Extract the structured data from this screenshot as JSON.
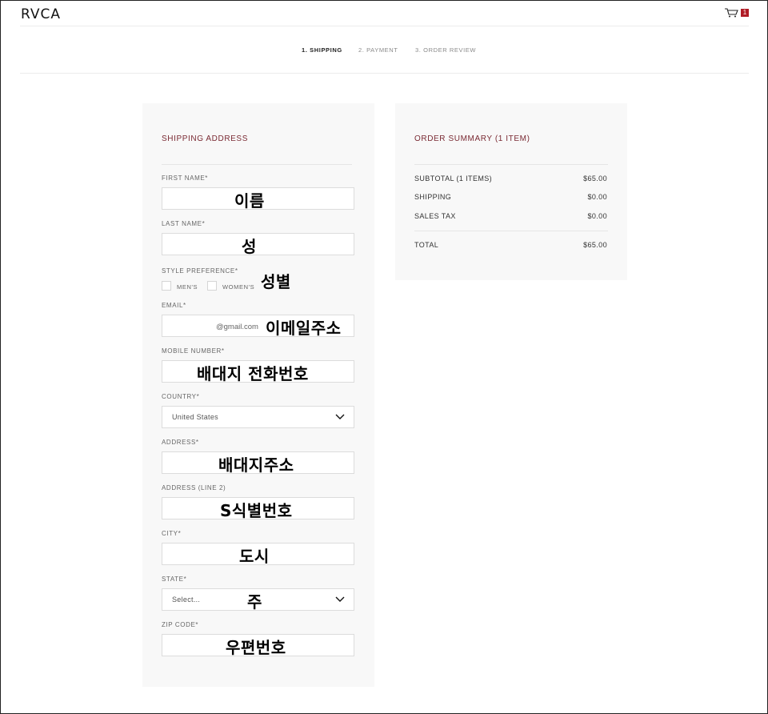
{
  "header": {
    "logo": "RVCA",
    "cart_count": "1"
  },
  "steps": [
    "1. SHIPPING",
    "2. PAYMENT",
    "3. ORDER REVIEW"
  ],
  "shipping": {
    "title": "SHIPPING ADDRESS",
    "first_name": {
      "label": "FIRST NAME*",
      "overlay": "이름"
    },
    "last_name": {
      "label": "LAST NAME*",
      "overlay": "성"
    },
    "style": {
      "label": "STYLE PREFERENCE*",
      "overlay": "성별",
      "options": [
        "MEN'S",
        "WOMEN'S"
      ]
    },
    "email": {
      "label": "EMAIL*",
      "value": "@gmail.com",
      "overlay": "이메일주소"
    },
    "mobile": {
      "label": "MOBILE NUMBER*",
      "overlay": "배대지 전화번호"
    },
    "country": {
      "label": "COUNTRY*",
      "value": "United States"
    },
    "address": {
      "label": "ADDRESS*",
      "overlay": "배대지주소"
    },
    "address2": {
      "label": "ADDRESS (LINE 2)",
      "overlay": "S식별번호"
    },
    "city": {
      "label": "CITY*",
      "overlay": "도시"
    },
    "state": {
      "label": "STATE*",
      "value": "Select...",
      "overlay": "주"
    },
    "zip": {
      "label": "ZIP CODE*",
      "overlay": "우편번호"
    }
  },
  "summary": {
    "title": "ORDER SUMMARY (1 ITEM)",
    "rows": [
      {
        "label": "SUBTOTAL (1 ITEMS)",
        "value": "$65.00"
      },
      {
        "label": "SHIPPING",
        "value": "$0.00"
      },
      {
        "label": "SALES TAX",
        "value": "$0.00"
      }
    ],
    "total": {
      "label": "TOTAL",
      "value": "$65.00"
    }
  },
  "colors": {
    "accent": "#7a2a33",
    "badge": "#b01c26",
    "panel": "#f8f8f8"
  }
}
